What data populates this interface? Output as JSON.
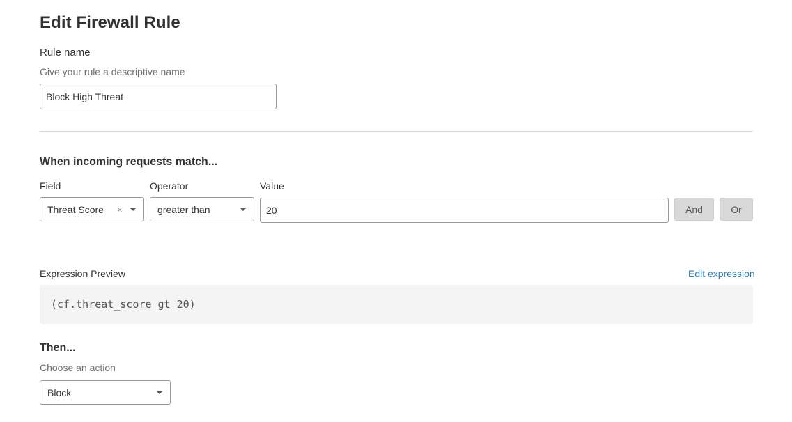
{
  "page": {
    "title": "Edit Firewall Rule"
  },
  "rule_name": {
    "label": "Rule name",
    "hint": "Give your rule a descriptive name",
    "value": "Block High Threat"
  },
  "match": {
    "heading": "When incoming requests match...",
    "field_label": "Field",
    "operator_label": "Operator",
    "value_label": "Value",
    "field_value": "Threat Score",
    "field_clear_glyph": "×",
    "operator_value": "greater than",
    "value_value": "20",
    "and_label": "And",
    "or_label": "Or"
  },
  "expression": {
    "label": "Expression Preview",
    "edit_link": "Edit expression",
    "code": "(cf.threat_score gt 20)"
  },
  "action": {
    "heading": "Then...",
    "hint": "Choose an action",
    "value": "Block"
  },
  "icons": {
    "clear": "close-icon",
    "dropdown": "chevron-down-icon"
  },
  "colors": {
    "link": "#2c7cb0",
    "button_bg": "#d9d9d9",
    "code_bg": "#f4f4f4",
    "border": "#9b9b9b"
  }
}
